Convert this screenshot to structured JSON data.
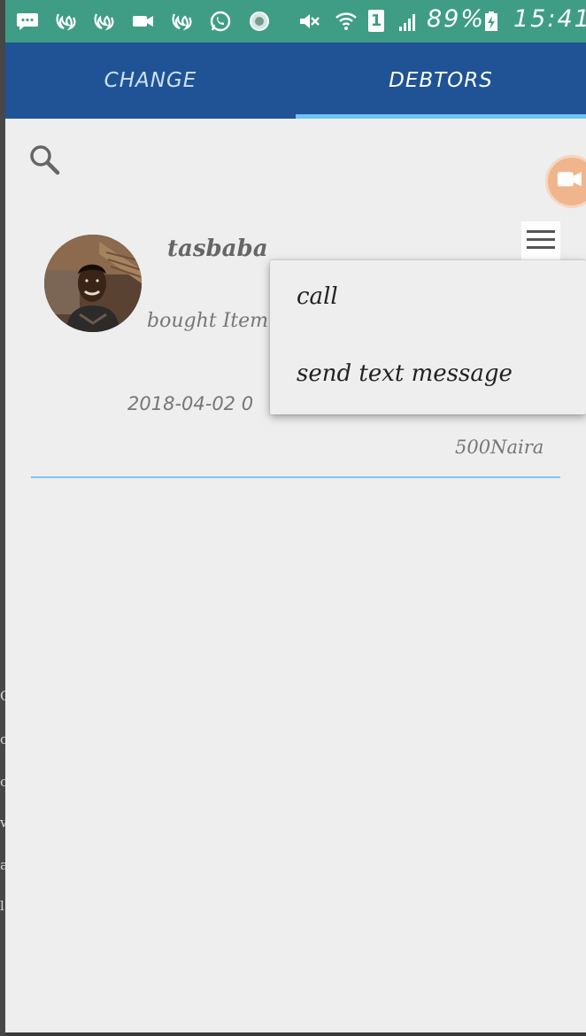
{
  "status_bar": {
    "battery": "89%",
    "sim": "1",
    "time": "15:41",
    "icons": [
      "messages-icon",
      "uc-browser-icon",
      "uc-browser-icon",
      "video-icon",
      "uc-browser-icon",
      "whatsapp-icon",
      "globe-app-icon",
      "mute-icon",
      "wifi-icon",
      "sim-icon",
      "signal-icon",
      "battery-charging-icon"
    ]
  },
  "tabs": [
    {
      "label": "CHANGE",
      "active": false
    },
    {
      "label": "DEBTORS",
      "active": true
    }
  ],
  "debtor": {
    "name": "tasbaba",
    "description": "bought Item",
    "date": "2018-04-02 0",
    "amount": "500Naira"
  },
  "popup_menu": {
    "items": [
      "call",
      "send text message"
    ]
  },
  "colors": {
    "status_bar": "#3f9d86",
    "tab_bar": "#1f5395",
    "tab_indicator": "#6cc3f4",
    "background": "#eeeeee",
    "divider": "#7cc8ef",
    "floating_button": "#f0b58d"
  }
}
